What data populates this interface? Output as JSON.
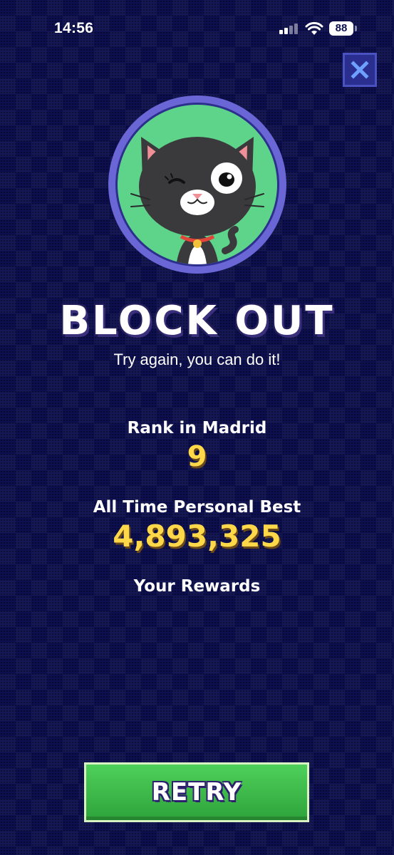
{
  "status_bar": {
    "time": "14:56",
    "battery": "88",
    "signal_icon": "cellular-signal-icon",
    "wifi_icon": "wifi-icon"
  },
  "close_icon": "close-icon",
  "avatar": {
    "icon": "black-cat-avatar",
    "ring_color": "#6a66d6",
    "background_color": "#5ed48a"
  },
  "result": {
    "title": "BLOCK OUT",
    "subtitle": "Try again, you can do it!"
  },
  "rank": {
    "label": "Rank in Madrid",
    "value": "9"
  },
  "personal_best": {
    "label": "All Time Personal Best",
    "value": "4,893,325"
  },
  "rewards": {
    "label": "Your Rewards"
  },
  "retry_button": {
    "label": "RETRY",
    "color": "#3cbf48"
  },
  "colors": {
    "background": "#0c1050",
    "accent_yellow": "#ffd84a"
  }
}
